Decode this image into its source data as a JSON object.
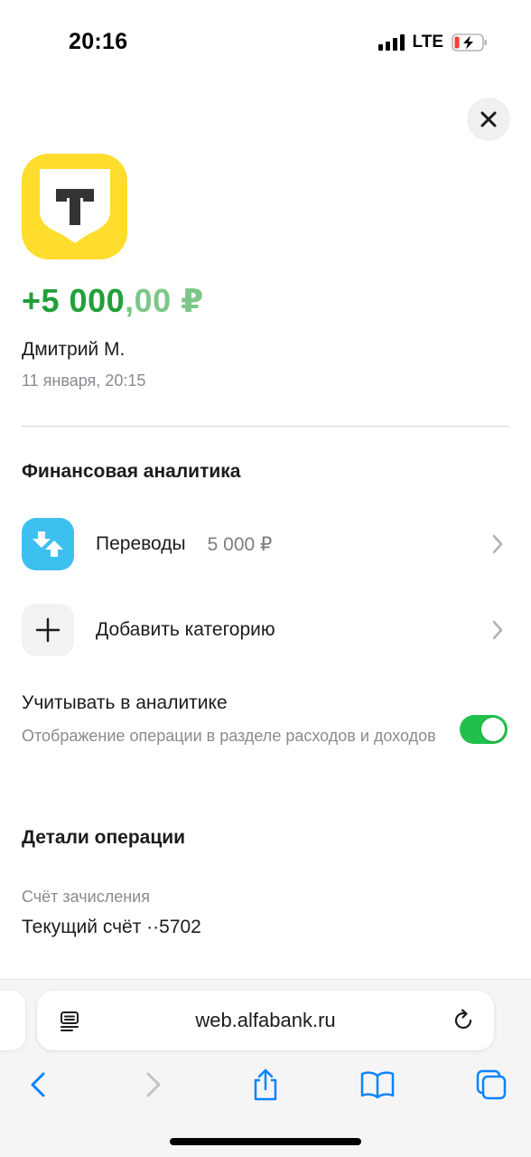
{
  "status_bar": {
    "time": "20:16",
    "network": "LTE",
    "icons": [
      "signal-icon",
      "battery-charging-icon"
    ]
  },
  "header": {
    "close_icon": "close-icon"
  },
  "operation": {
    "logo": "tinkoff-logo",
    "logo_letter": "Т",
    "amount_major": "+5 000",
    "amount_minor": ",00 ₽",
    "sender": "Дмитрий М.",
    "datetime": "11 января, 20:15"
  },
  "analytics": {
    "title": "Финансовая аналитика",
    "category": {
      "label": "Переводы",
      "value": "5 000 ₽",
      "icon": "transfer-arrows-icon"
    },
    "add_category": {
      "label": "Добавить категорию",
      "icon": "plus-icon"
    },
    "toggle": {
      "title": "Учитывать в аналитике",
      "subtitle": "Отображение операции в разделе расходов и доходов",
      "enabled": true
    }
  },
  "details": {
    "title": "Детали операции",
    "account_label": "Счёт зачисления",
    "account_value": "Текущий счёт ··5702"
  },
  "browser": {
    "url": "web.alfabank.ru",
    "toolbar": [
      "back-icon",
      "forward-icon",
      "share-icon",
      "bookmarks-icon",
      "tabs-icon"
    ]
  },
  "colors": {
    "income_green": "#21a038",
    "toggle_green": "#21c04a",
    "tinkoff_yellow": "#ffdd2d",
    "transfer_blue": "#3cc0f0",
    "safari_blue": "#0a84ff"
  }
}
